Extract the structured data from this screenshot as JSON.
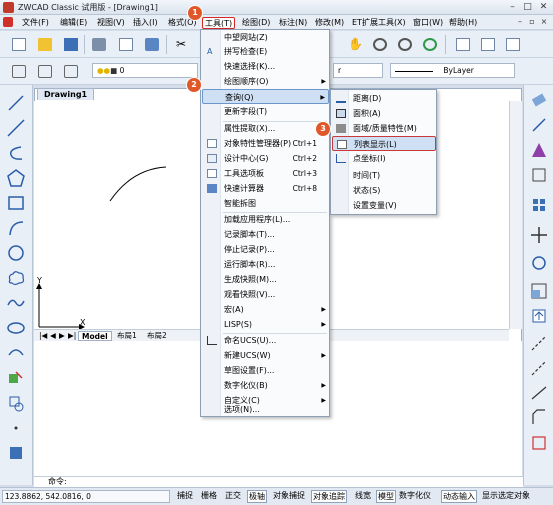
{
  "window": {
    "title": "ZWCAD Classic 试用版 - [Drawing1]"
  },
  "menubar": {
    "items": [
      "文件(F)",
      "编辑(E)",
      "视图(V)",
      "插入(I)",
      "格式(O)",
      "工具(T)",
      "绘图(D)",
      "标注(N)",
      "修改(M)",
      "ET扩展工具(X)",
      "窗口(W)",
      "帮助(H)"
    ]
  },
  "toolbar2": {
    "layer_value": "ByLayer",
    "layer_color_value": "0"
  },
  "tools_menu": {
    "items": [
      {
        "label": "中望网站(Z)"
      },
      {
        "label": "拼写检查(E)"
      },
      {
        "label": "快速选择(K)..."
      },
      {
        "label": "绘图顺序(O)",
        "arrow": "▶"
      },
      {
        "label": "查询(Q)",
        "arrow": "▶"
      },
      {
        "label": "更新字段(T)"
      },
      {
        "label": "属性提取(X)..."
      },
      {
        "label": "对象特性管理器(P)",
        "shortcut": "Ctrl+1"
      },
      {
        "label": "设计中心(G)",
        "shortcut": "Ctrl+2"
      },
      {
        "label": "工具选项板",
        "shortcut": "Ctrl+3"
      },
      {
        "label": "快速计算器",
        "shortcut": "Ctrl+8"
      },
      {
        "label": "智能拆图"
      },
      {
        "label": "加载应用程序(L)..."
      },
      {
        "label": "记录脚本(T)..."
      },
      {
        "label": "停止记录(P)..."
      },
      {
        "label": "运行脚本(R)..."
      },
      {
        "label": "生成快照(M)..."
      },
      {
        "label": "观看快照(V)..."
      },
      {
        "label": "宏(A)",
        "arrow": "▶"
      },
      {
        "label": "LISP(S)",
        "arrow": "▶"
      },
      {
        "label": "命名UCS(U)..."
      },
      {
        "label": "新建UCS(W)",
        "arrow": "▶"
      },
      {
        "label": "草图设置(F)..."
      },
      {
        "label": "数字化仪(B)",
        "arrow": "▶"
      },
      {
        "label": "自定义(C)",
        "arrow": "▶"
      },
      {
        "label": "选项(N)..."
      }
    ]
  },
  "query_submenu": {
    "items": [
      "距离(D)",
      "面积(A)",
      "面域/质量特性(M)",
      "列表显示(L)",
      "点坐标(I)",
      "时间(T)",
      "状态(S)",
      "设置变量(V)"
    ]
  },
  "steps": [
    "1",
    "2",
    "3"
  ],
  "canvas": {
    "tab": "Drawing1",
    "axis_x": "X",
    "axis_y": "Y"
  },
  "layout_tabs": [
    "Model",
    "布局1",
    "布局2"
  ],
  "command_line": {
    "prompt": "命令:"
  },
  "statusbar": {
    "coords": "123.8862,  542.0816,  0",
    "buttons": [
      "捕捉",
      "栅格",
      "正交",
      "极轴",
      "对象捕捉",
      "对象追踪",
      "线宽",
      "模型",
      "数字化仪",
      "动态输入",
      "显示选定对象"
    ]
  },
  "colors": {
    "accent_red": "#d62626",
    "step_badge": "#e0582a",
    "highlight": "#cfe0f5"
  }
}
